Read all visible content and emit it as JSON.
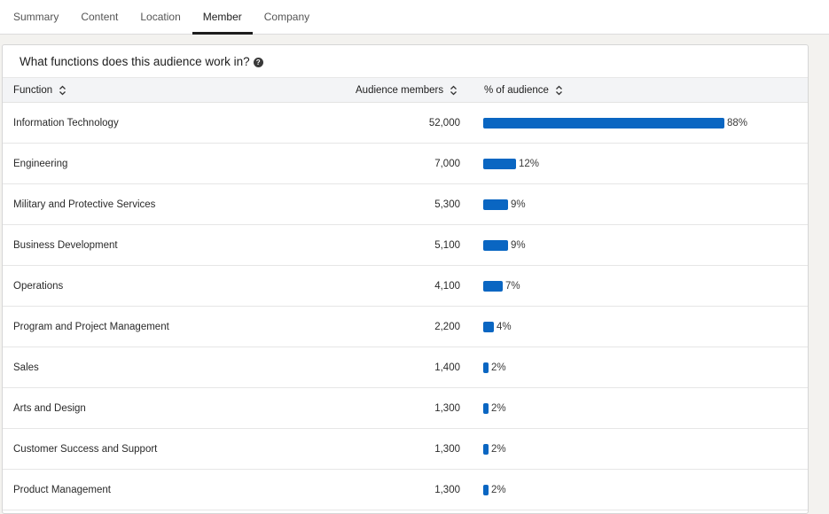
{
  "tabs": [
    {
      "label": "Summary",
      "active": false
    },
    {
      "label": "Content",
      "active": false
    },
    {
      "label": "Location",
      "active": false
    },
    {
      "label": "Member",
      "active": true
    },
    {
      "label": "Company",
      "active": false
    }
  ],
  "card": {
    "title": "What functions does this audience work in?",
    "help_icon": "question-circle-icon"
  },
  "table": {
    "columns": [
      {
        "label": "Function",
        "sort_icon": "sort-icon"
      },
      {
        "label": "Audience members",
        "sort_icon": "sort-icon"
      },
      {
        "label": "% of audience",
        "sort_icon": "sort-icon"
      }
    ],
    "rows": [
      {
        "function": "Information Technology",
        "members": "52,000",
        "percent_label": "88%",
        "percent": 88
      },
      {
        "function": "Engineering",
        "members": "7,000",
        "percent_label": "12%",
        "percent": 12
      },
      {
        "function": "Military and Protective Services",
        "members": "5,300",
        "percent_label": "9%",
        "percent": 9
      },
      {
        "function": "Business Development",
        "members": "5,100",
        "percent_label": "9%",
        "percent": 9
      },
      {
        "function": "Operations",
        "members": "4,100",
        "percent_label": "7%",
        "percent": 7
      },
      {
        "function": "Program and Project Management",
        "members": "2,200",
        "percent_label": "4%",
        "percent": 4
      },
      {
        "function": "Sales",
        "members": "1,400",
        "percent_label": "2%",
        "percent": 2
      },
      {
        "function": "Arts and Design",
        "members": "1,300",
        "percent_label": "2%",
        "percent": 2
      },
      {
        "function": "Customer Success and Support",
        "members": "1,300",
        "percent_label": "2%",
        "percent": 2
      },
      {
        "function": "Product Management",
        "members": "1,300",
        "percent_label": "2%",
        "percent": 2
      }
    ]
  },
  "colors": {
    "bar": "#0a66c2",
    "active_tab_underline": "#1d1d1d"
  }
}
